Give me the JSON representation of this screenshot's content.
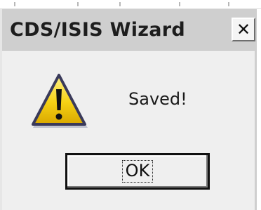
{
  "dialog": {
    "title": "CDS/ISIS Wizard",
    "close_glyph": "✕",
    "icon": "warning-icon",
    "message": "Saved!",
    "ok_label": "OK"
  },
  "colors": {
    "titlebar": "#cfcfcf",
    "body": "#efefef",
    "warning_yellow": "#f6d214",
    "warning_outline": "#3a3a5a"
  }
}
